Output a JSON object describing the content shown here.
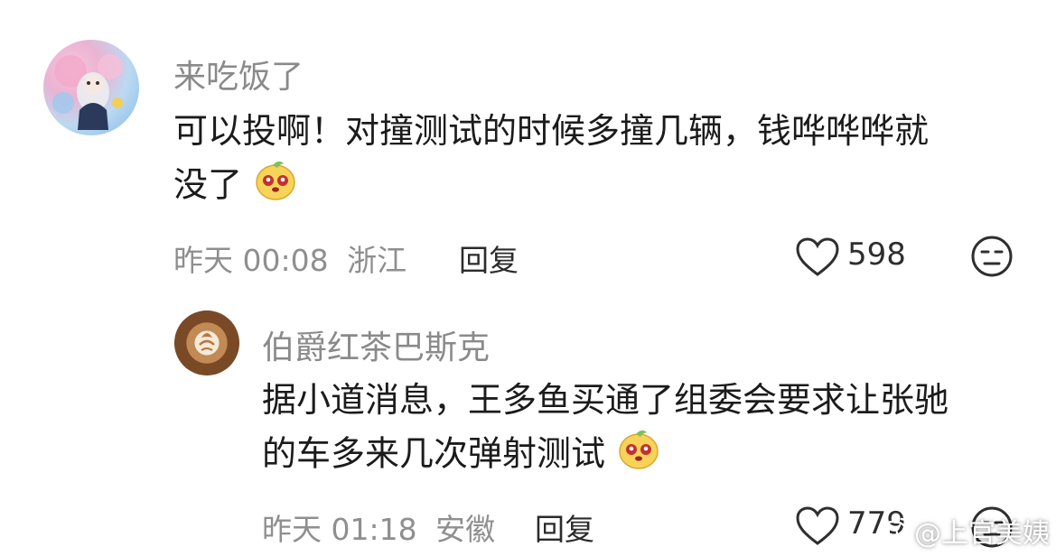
{
  "comments": [
    {
      "username": "来吃饭了",
      "text_line1": "可以投啊！对撞测试的时候多撞几辆，钱哗哗哗就",
      "text_line2": "没了",
      "emoji": "cute-face-emoji",
      "time": "昨天 00:08",
      "location": "浙江",
      "reply_label": "回复",
      "likes": "598"
    },
    {
      "username": "伯爵红茶巴斯克",
      "text_line1": "据小道消息，王多鱼买通了组委会要求让张驰",
      "text_line2": "的车多来几次弹射测试",
      "emoji": "cute-face-emoji",
      "time": "昨天 01:18",
      "location": "安徽",
      "reply_label": "回复",
      "likes": "779"
    }
  ],
  "watermark": "@上官美姨",
  "icons": {
    "like": "heart-outline-icon",
    "dislike": "meh-face-icon",
    "weibo": "weibo-logo-icon"
  },
  "colors": {
    "username": "#8a8a8a",
    "meta": "#8f8f8f",
    "text": "#1b1b1b"
  }
}
